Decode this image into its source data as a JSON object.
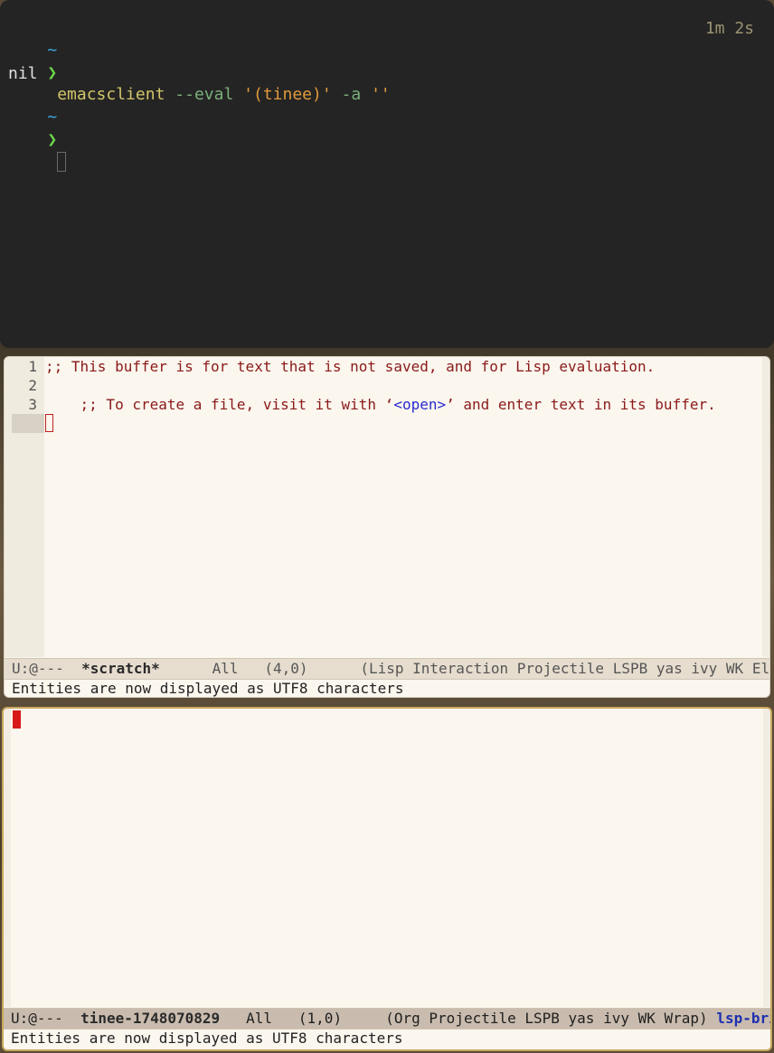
{
  "terminal": {
    "timer": "1m 2s",
    "tilde": "~",
    "prompt": "❯",
    "command": {
      "cmd": "emacsclient",
      "flag_eval": "--eval",
      "arg_eval": "'(tinee)'",
      "flag_a": "-a",
      "arg_a": "''"
    },
    "output": "nil"
  },
  "scratch": {
    "line_numbers": [
      "1",
      "2",
      "3"
    ],
    "line1": ";; This buffer is for text that is not saved, and for Lisp evaluation.",
    "line2_pre": ";; To create a file, visit it with ‘",
    "line2_link": "<open>",
    "line2_post": "’ and enter text in its buffer.",
    "modeline": {
      "status": "U:@---",
      "buffer": "*scratch*",
      "position": "All",
      "coords": "(4,0)",
      "modes": "(Lisp Interaction Projectile LSPB yas ivy WK ElDoc Wr"
    },
    "echo": "Entities are now displayed as UTF8 characters"
  },
  "org": {
    "modeline": {
      "status": "U:@---",
      "buffer": "tinee-1748070829",
      "position": "All",
      "coords": "(1,0)",
      "modes": "(Org Projectile LSPB yas ivy WK Wrap)",
      "lsp": "lsp-bridge"
    },
    "echo": "Entities are now displayed as UTF8 characters"
  },
  "colors": {
    "terminal_bg": "#242424",
    "emacs_bg": "#fbf6ee",
    "comment": "#8a1a1a",
    "link": "#2a2ad0",
    "cursor": "#d81818",
    "frame2_border": "#c9a75e"
  }
}
